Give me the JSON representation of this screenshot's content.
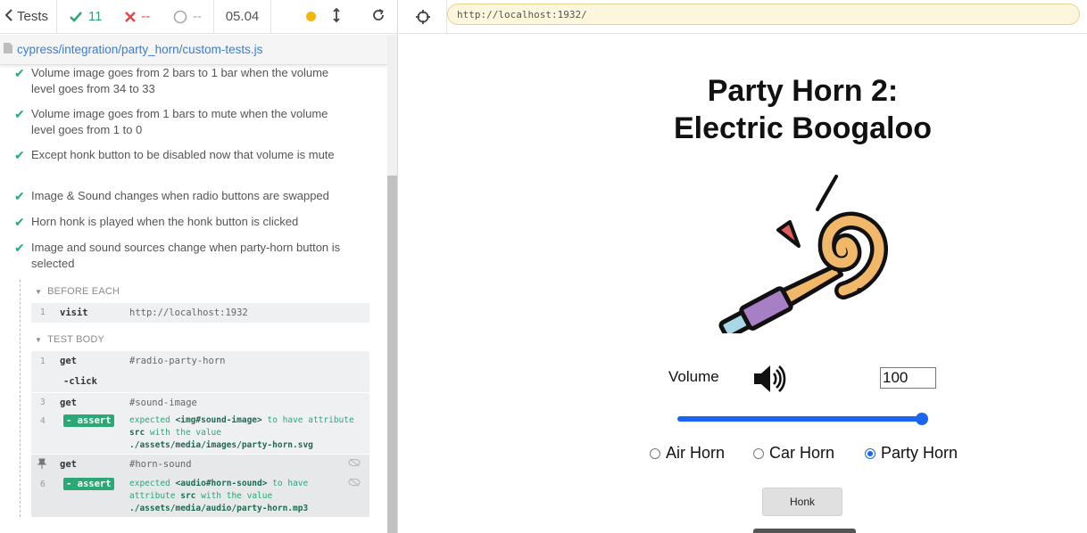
{
  "reporter": {
    "back_label": "Tests",
    "stats": {
      "passed": "11",
      "failed": "--",
      "pending": "--"
    },
    "duration": "05.04",
    "spec_path": "cypress/integration/party_horn/custom-tests.js",
    "tests": [
      "Volume image goes from 2 bars to 1 bar when the volume level goes from 34 to 33",
      "Volume image goes from 1 bars to mute when the volume level goes from 1 to 0",
      "Except honk button to be disabled now that volume is mute",
      "Image & Sound changes when radio buttons are swapped",
      "Horn honk is played when the honk button is clicked",
      "Image and sound sources change when party-horn button is selected"
    ],
    "before_each_title": "BEFORE EACH",
    "test_body_title": "TEST BODY",
    "before_each": [
      {
        "num": "1",
        "name": "visit",
        "msg": "http://localhost:1932"
      }
    ],
    "test_body": [
      {
        "num": "1",
        "name": "get",
        "msg": "#radio-party-horn"
      },
      {
        "num": "",
        "name": "-click",
        "msg": ""
      },
      {
        "num": "3",
        "name": "get",
        "msg": "#sound-image"
      },
      {
        "num": "4",
        "name": "- assert",
        "msg_parts": [
          "expected",
          "<img#sound-image>",
          "to have attribute",
          "src",
          "with the value",
          "./assets/media/images/party-horn.svg"
        ]
      },
      {
        "num": "",
        "name": "get",
        "msg": "#horn-sound"
      },
      {
        "num": "6",
        "name": "- assert",
        "msg_parts": [
          "expected",
          "<audio#horn-sound>",
          "to have attribute",
          "src",
          "with the value",
          "./assets/media/audio/party-horn.mp3"
        ]
      }
    ]
  },
  "aut": {
    "url": "http://localhost:1932/",
    "title_line1": "Party Horn 2:",
    "title_line2": "Electric Boogaloo",
    "volume_label": "Volume",
    "volume_value": "100",
    "volume_level": 100,
    "radios": [
      {
        "label": "Air Horn",
        "checked": false
      },
      {
        "label": "Car Horn",
        "checked": false
      },
      {
        "label": "Party Horn",
        "checked": true
      }
    ],
    "honk_label": "Honk"
  },
  "colors": {
    "pass": "#2aa876",
    "fail": "#e24848",
    "accent": "#1a66f0",
    "url_bg": "#fcf6dd"
  },
  "icons": [
    "chevron-left-icon",
    "check-icon",
    "x-icon",
    "spinner-icon",
    "pause-dot-icon",
    "resize-icon",
    "reload-icon",
    "crosshair-icon",
    "file-icon",
    "pin-icon",
    "eye-slash-icon",
    "volume-icon",
    "party-horn-image"
  ]
}
